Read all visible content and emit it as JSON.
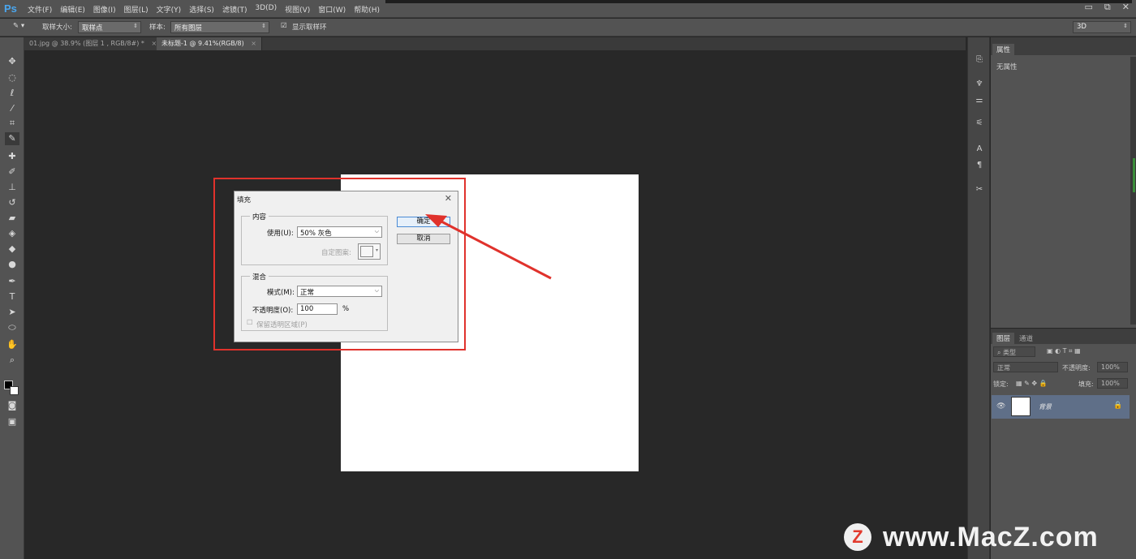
{
  "app": {
    "logo": "Ps"
  },
  "menu": [
    "文件(F)",
    "编辑(E)",
    "图像(I)",
    "图层(L)",
    "文字(Y)",
    "选择(S)",
    "滤镜(T)",
    "3D(D)",
    "视图(V)",
    "窗口(W)",
    "帮助(H)"
  ],
  "window_controls": {
    "minimize": "▭",
    "restore": "⧉",
    "close": "✕"
  },
  "options": {
    "sample_size_label": "取样大小:",
    "sample_size_value": "取样点",
    "sample_label": "样本:",
    "sample_value": "所有图层",
    "show_ring_label": "显示取样环",
    "workspace_value": "3D"
  },
  "tabs": [
    {
      "label": "01.jpg @ 38.9% (图层 1 , RGB/8#) *",
      "close": "×"
    },
    {
      "label": "未标题-1 @ 9.41%(RGB/8)",
      "close": "×"
    }
  ],
  "dialog": {
    "title": "填充",
    "close": "✕",
    "contents_group": "内容",
    "use_label": "使用(U):",
    "use_value": "50% 灰色",
    "custom_pattern_label": "自定图案:",
    "blending_group": "混合",
    "mode_label": "模式(M):",
    "mode_value": "正常",
    "opacity_label": "不透明度(O):",
    "opacity_value": "100",
    "opacity_unit": "%",
    "preserve_label": "保留透明区域(P)",
    "ok_label": "确定",
    "cancel_label": "取消"
  },
  "properties_panel": {
    "tab": "属性",
    "empty_text": "无属性"
  },
  "layers_panel": {
    "tabs": [
      "图层",
      "通道"
    ],
    "filter_label": "类型",
    "blend_mode": "正常",
    "opacity_label": "不透明度:",
    "opacity_value": "100%",
    "lock_label": "锁定:",
    "fill_label": "填充:",
    "fill_value": "100%",
    "layers": [
      {
        "name": "背景",
        "visible": true,
        "locked": true
      }
    ]
  },
  "watermark": {
    "logo": "Z",
    "text": "www.MacZ.com"
  },
  "colors": {
    "annotation": "#e0322c",
    "selected_layer": "#5f6f88",
    "ps_blue": "#4aa7f0"
  }
}
